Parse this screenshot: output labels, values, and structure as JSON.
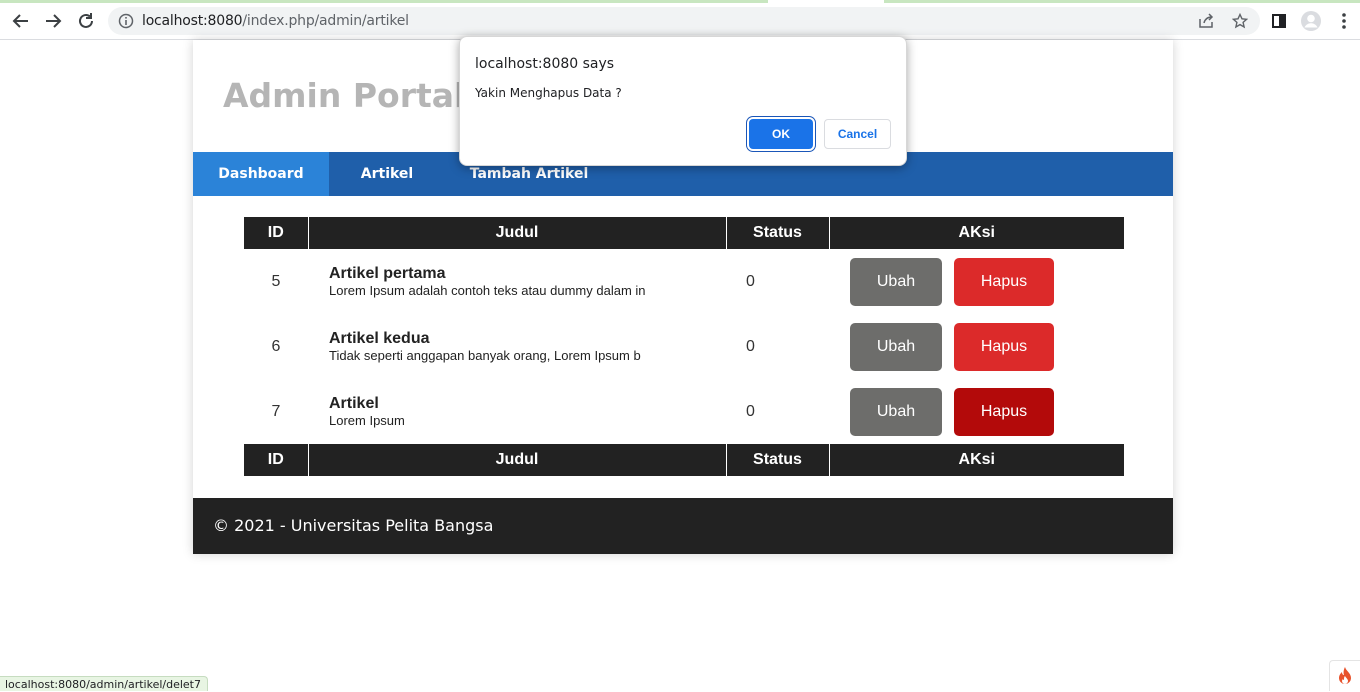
{
  "browser": {
    "url_host": "localhost:8080",
    "url_path": "/index.php/admin/artikel",
    "status_url": "localhost:8080/admin/artikel/delet7"
  },
  "site": {
    "title": "Admin Portal B",
    "nav": [
      {
        "label": "Dashboard"
      },
      {
        "label": "Artikel"
      },
      {
        "label": "Tambah Artikel"
      }
    ],
    "footer": "© 2021 - Universitas Pelita Bangsa"
  },
  "table": {
    "headers": [
      "ID",
      "Judul",
      "Status",
      "AKsi"
    ],
    "rows": [
      {
        "id": "5",
        "title": "Artikel pertama",
        "excerpt": "Lorem Ipsum adalah contoh teks atau dummy dalam in",
        "status": "0",
        "edit": "Ubah",
        "delete": "Hapus"
      },
      {
        "id": "6",
        "title": "Artikel kedua",
        "excerpt": "Tidak seperti anggapan banyak orang, Lorem Ipsum b",
        "status": "0",
        "edit": "Ubah",
        "delete": "Hapus"
      },
      {
        "id": "7",
        "title": "Artikel",
        "excerpt": "Lorem Ipsum",
        "status": "0",
        "edit": "Ubah",
        "delete": "Hapus"
      }
    ]
  },
  "dialog": {
    "title": "localhost:8080 says",
    "message": "Yakin Menghapus Data ?",
    "ok_label": "OK",
    "cancel_label": "Cancel"
  },
  "colors": {
    "nav_bg": "#1f5faa",
    "nav_active": "#2b83d8",
    "header_bg": "#222222",
    "edit_btn": "#6d6d6b",
    "delete_btn": "#dc2a2a",
    "delete_btn_hover": "#b30a0a",
    "dialog_ok": "#1a73e8"
  }
}
